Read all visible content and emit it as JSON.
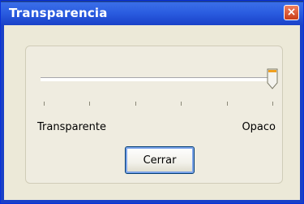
{
  "window": {
    "title": "Transparencia",
    "close_glyph": "×"
  },
  "slider": {
    "value_percent": 100,
    "tick_count": 6,
    "min_label": "Transparente",
    "max_label": "Opaco"
  },
  "buttons": {
    "close_label": "Cerrar"
  },
  "colors": {
    "titlebar": "#2a5ce0",
    "thumb_accent": "#f0a020",
    "face": "#ece9d8"
  }
}
